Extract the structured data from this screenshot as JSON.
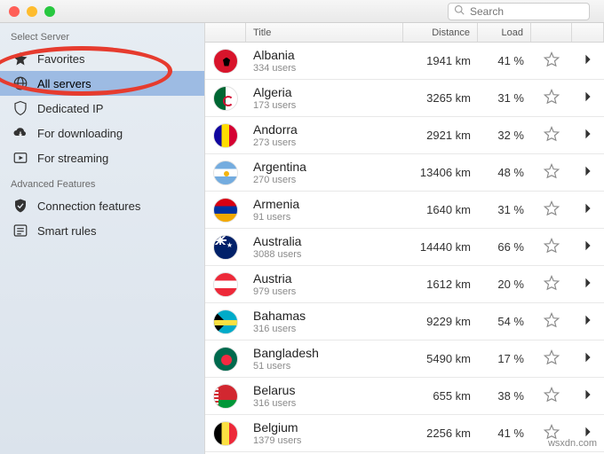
{
  "search": {
    "placeholder": "Search"
  },
  "sidebar": {
    "sections": [
      {
        "title": "Select Server",
        "items": [
          {
            "label": "Favorites",
            "icon": "star",
            "selected": false
          },
          {
            "label": "All servers",
            "icon": "globe",
            "selected": true
          },
          {
            "label": "Dedicated IP",
            "icon": "shield",
            "selected": false
          },
          {
            "label": "For downloading",
            "icon": "cloud-down",
            "selected": false
          },
          {
            "label": "For streaming",
            "icon": "play-rect",
            "selected": false
          }
        ]
      },
      {
        "title": "Advanced Features",
        "items": [
          {
            "label": "Connection features",
            "icon": "shield-check",
            "selected": false
          },
          {
            "label": "Smart rules",
            "icon": "list",
            "selected": false
          }
        ]
      }
    ]
  },
  "columns": {
    "title": "Title",
    "distance": "Distance",
    "load": "Load"
  },
  "servers": [
    {
      "country": "Albania",
      "users": "334 users",
      "distance": "1941 km",
      "load": "41 %",
      "flag": "al"
    },
    {
      "country": "Algeria",
      "users": "173 users",
      "distance": "3265 km",
      "load": "31 %",
      "flag": "dz"
    },
    {
      "country": "Andorra",
      "users": "273 users",
      "distance": "2921 km",
      "load": "32 %",
      "flag": "ad"
    },
    {
      "country": "Argentina",
      "users": "270 users",
      "distance": "13406 km",
      "load": "48 %",
      "flag": "ar"
    },
    {
      "country": "Armenia",
      "users": "91 users",
      "distance": "1640 km",
      "load": "31 %",
      "flag": "am"
    },
    {
      "country": "Australia",
      "users": "3088 users",
      "distance": "14440 km",
      "load": "66 %",
      "flag": "au"
    },
    {
      "country": "Austria",
      "users": "979 users",
      "distance": "1612 km",
      "load": "20 %",
      "flag": "at"
    },
    {
      "country": "Bahamas",
      "users": "316 users",
      "distance": "9229 km",
      "load": "54 %",
      "flag": "bs"
    },
    {
      "country": "Bangladesh",
      "users": "51 users",
      "distance": "5490 km",
      "load": "17 %",
      "flag": "bd"
    },
    {
      "country": "Belarus",
      "users": "316 users",
      "distance": "655 km",
      "load": "38 %",
      "flag": "by"
    },
    {
      "country": "Belgium",
      "users": "1379 users",
      "distance": "2256 km",
      "load": "41 %",
      "flag": "be"
    }
  ],
  "watermark": "wsxdn.com"
}
